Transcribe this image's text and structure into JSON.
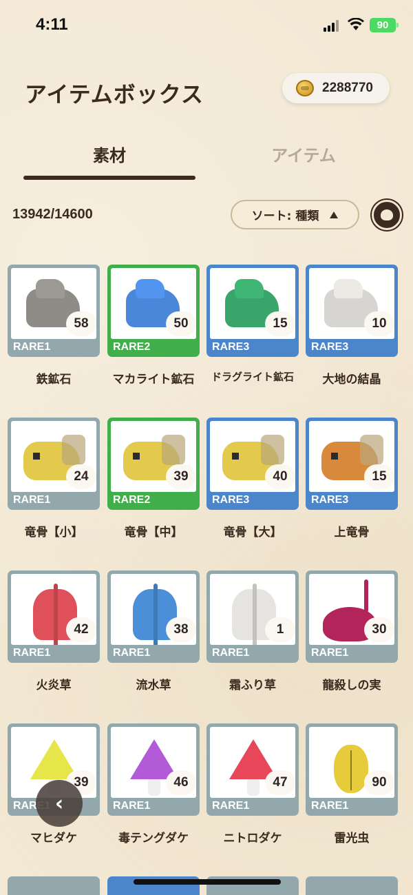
{
  "status_bar": {
    "time": "4:11",
    "battery": "90"
  },
  "header": {
    "title": "アイテムボックス",
    "coins": "2288770"
  },
  "tabs": [
    {
      "label": "素材",
      "active": true
    },
    {
      "label": "アイテム",
      "active": false
    }
  ],
  "toolbar": {
    "count": "13942/14600",
    "sort_label": "ソート: 種類"
  },
  "items": [
    {
      "name": "鉄鉱石",
      "rare": "RARE1",
      "qty": "58"
    },
    {
      "name": "マカライト鉱石",
      "rare": "RARE2",
      "qty": "50"
    },
    {
      "name": "ドラグライト鉱石",
      "rare": "RARE3",
      "qty": "15"
    },
    {
      "name": "大地の結晶",
      "rare": "RARE3",
      "qty": "10"
    },
    {
      "name": "竜骨【小】",
      "rare": "RARE1",
      "qty": "24"
    },
    {
      "name": "竜骨【中】",
      "rare": "RARE2",
      "qty": "39"
    },
    {
      "name": "竜骨【大】",
      "rare": "RARE3",
      "qty": "40"
    },
    {
      "name": "上竜骨",
      "rare": "RARE3",
      "qty": "15"
    },
    {
      "name": "火炎草",
      "rare": "RARE1",
      "qty": "42"
    },
    {
      "name": "流水草",
      "rare": "RARE1",
      "qty": "38"
    },
    {
      "name": "霜ふり草",
      "rare": "RARE1",
      "qty": "1"
    },
    {
      "name": "龍殺しの実",
      "rare": "RARE1",
      "qty": "30"
    },
    {
      "name": "マヒダケ",
      "rare": "RARE1",
      "qty": "39"
    },
    {
      "name": "毒テングダケ",
      "rare": "RARE1",
      "qty": "46"
    },
    {
      "name": "ニトロダケ",
      "rare": "RARE1",
      "qty": "47"
    },
    {
      "name": "雷光虫",
      "rare": "RARE1",
      "qty": "90"
    }
  ],
  "colors": {
    "rare1": "#92a8ad",
    "rare2": "#3fae4b",
    "rare3": "#4a86c9",
    "text": "#3a2a1f"
  },
  "icons": [
    "coin-icon",
    "sort-arrow-icon",
    "monster-filter-icon",
    "chevron-left-icon"
  ]
}
